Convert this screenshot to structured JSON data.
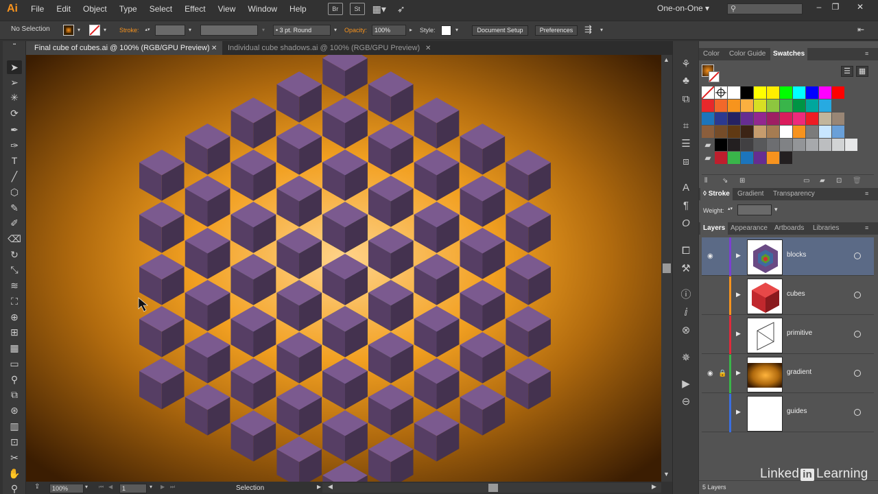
{
  "app": {
    "logo": "Ai"
  },
  "menu": [
    "File",
    "Edit",
    "Object",
    "Type",
    "Select",
    "Effect",
    "View",
    "Window",
    "Help"
  ],
  "menubar_icons": {
    "br": "Br",
    "st": "St"
  },
  "workspace": "One-on-One",
  "window_controls": {
    "minimize": "–",
    "restore": "❐",
    "close": "✕"
  },
  "control_bar": {
    "selection_label": "No Selection",
    "stroke_label": "Stroke:",
    "brush_value": "3 pt. Round",
    "opacity_label": "Opacity:",
    "opacity_value": "100%",
    "style_label": "Style:",
    "document_setup": "Document Setup",
    "preferences": "Preferences"
  },
  "tabs": [
    {
      "label": "Final cube of cubes.ai @ 100% (RGB/GPU Preview)",
      "active": true
    },
    {
      "label": "Individual cube shadows.ai @ 100% (RGB/GPU Preview)",
      "active": false
    }
  ],
  "status": {
    "zoom": "100%",
    "artboard": "1",
    "tool": "Selection"
  },
  "panels": {
    "top_tabs": [
      "Color",
      "Color Guide",
      "Swatches"
    ],
    "mid_tabs": [
      "Stroke",
      "Gradient",
      "Transparency"
    ],
    "weight_label": "Weight:",
    "bottom_tabs": [
      "Layers",
      "Appearance",
      "Artboards",
      "Libraries"
    ],
    "layers": [
      {
        "name": "blocks",
        "color": "#7b3fd0",
        "selected": true,
        "visible": true,
        "locked": false
      },
      {
        "name": "cubes",
        "color": "#f7931e",
        "selected": false,
        "visible": false,
        "locked": false
      },
      {
        "name": "primitive",
        "color": "#e02a3a",
        "selected": false,
        "visible": false,
        "locked": false
      },
      {
        "name": "gradient",
        "color": "#39b54a",
        "selected": false,
        "visible": true,
        "locked": true
      },
      {
        "name": "guides",
        "color": "#3a6ee0",
        "selected": false,
        "visible": false,
        "locked": false
      }
    ],
    "layers_count": "5 Layers"
  },
  "watermark": {
    "pre": "Linked",
    "in": "in",
    "post": "Learning"
  }
}
